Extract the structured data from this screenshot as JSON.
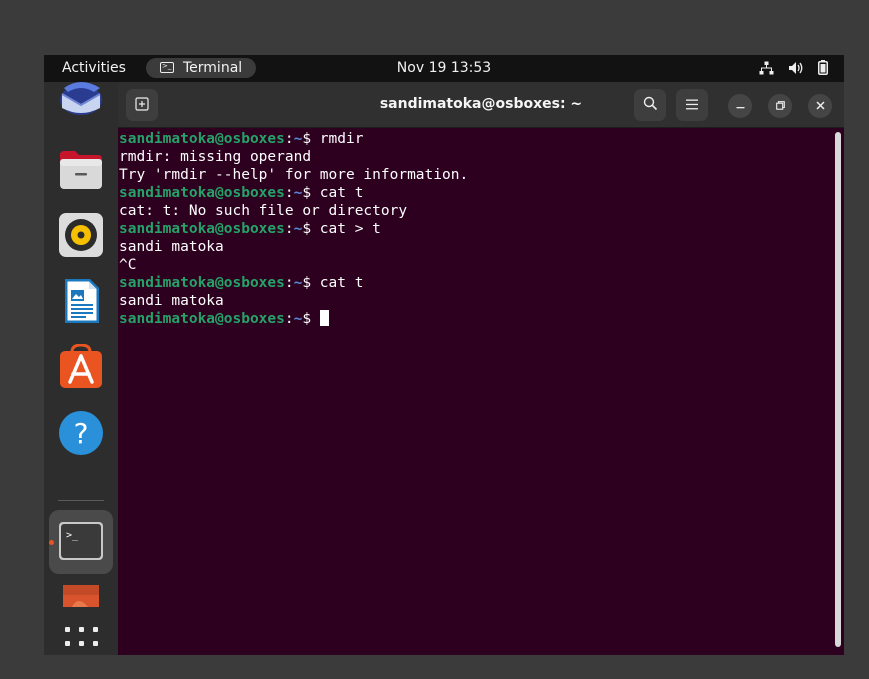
{
  "topbar": {
    "activities": "Activities",
    "app_name": "Terminal",
    "clock": "Nov 19  13:53"
  },
  "dock": {
    "items": [
      {
        "name": "Thunderbird Mail",
        "icon": "thunderbird-icon"
      },
      {
        "name": "Files",
        "icon": "files-icon"
      },
      {
        "name": "Rhythmbox",
        "icon": "rhythmbox-icon"
      },
      {
        "name": "LibreOffice Writer",
        "icon": "writer-icon"
      },
      {
        "name": "Ubuntu Software",
        "icon": "software-icon"
      },
      {
        "name": "Help",
        "icon": "help-icon",
        "glyph": "?"
      },
      {
        "name": "Terminal",
        "icon": "terminal-icon",
        "glyph": ">_",
        "active": true
      },
      {
        "name": "Application",
        "icon": "app-icon"
      },
      {
        "name": "Show Applications",
        "icon": "apps-grid-icon"
      }
    ],
    "accent": "#e95420"
  },
  "terminal": {
    "title": "sandimatoka@osboxes: ~",
    "background": "#2c001e",
    "prompt_user": "sandimatoka@osboxes",
    "prompt_path": "~",
    "lines": [
      {
        "prompt": true,
        "user": "sandimatoka@osboxes",
        "sep": ":",
        "path": "~",
        "cmd": "$ rmdir"
      },
      {
        "prompt": false,
        "text": "rmdir: missing operand"
      },
      {
        "prompt": false,
        "text": "Try 'rmdir --help' for more information."
      },
      {
        "prompt": true,
        "user": "sandimatoka@osboxes",
        "sep": ":",
        "path": "~",
        "cmd": "$ cat t"
      },
      {
        "prompt": false,
        "text": "cat: t: No such file or directory"
      },
      {
        "prompt": true,
        "user": "sandimatoka@osboxes",
        "sep": ":",
        "path": "~",
        "cmd": "$ cat > t"
      },
      {
        "prompt": false,
        "text": "sandi matoka"
      },
      {
        "prompt": false,
        "text": "^C"
      },
      {
        "prompt": true,
        "user": "sandimatoka@osboxes",
        "sep": ":",
        "path": "~",
        "cmd": "$ cat t"
      },
      {
        "prompt": false,
        "text": "sandi matoka"
      },
      {
        "prompt": true,
        "user": "sandimatoka@osboxes",
        "sep": ":",
        "path": "~",
        "cmd": "$ ",
        "cursor": true
      }
    ]
  },
  "colors": {
    "prompt_user": "#26a269",
    "prompt_path": "#5b88d6",
    "topbar": "#121212",
    "headerbar": "#303030"
  }
}
